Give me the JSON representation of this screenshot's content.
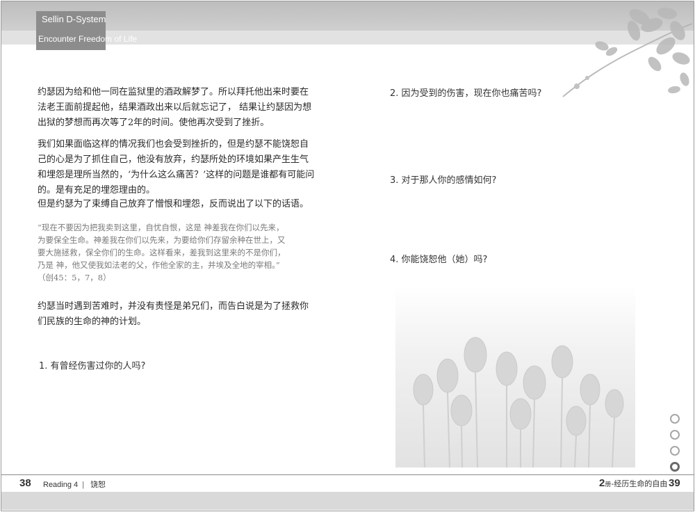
{
  "header": {
    "brand_title": "Sellin D-System",
    "brand_subtitle": "Encounter Freedom of Life"
  },
  "left_page": {
    "paragraphs": [
      "约瑟因为给和他一同在监狱里的酒政解梦了。所以拜托他出来时要在法老王面前提起他，结果酒政出来以后就忘记了， 结果让约瑟因为想出狱的梦想而再次等了2年的时间。使他再次受到了挫折。",
      "我们如果面临这样的情况我们也会受到挫折的，但是约瑟不能饶恕自己的心是为了抓住自己，他没有放弃，约瑟所处的环境如果产生生气和埋怨是理所当然的，‘为什么这么痛苦？’这样的问题是谁都有可能问的。是有充足的埋怨理由的。",
      "但是约瑟为了束缚自己放弃了憎恨和埋怨，反而说出了以下的话语。"
    ],
    "quote_lines": [
      "“现在不要因为把我卖到这里，自忧自恨，这是  神差我在你们以先来，",
      "为要保全生命。神差我在你们以先来，为要给你们存留余种在世上，又",
      "要大施拯救，保全你们的生命。这样看来，差我到这里来的不是你们，",
      "乃是  神，他又使我如法老的父，作他全家的主，并埃及全地的宰相。”",
      "（创45：5，7，8）"
    ],
    "closing_paragraph": "约瑟当时遇到苦难时，并没有责怪是弟兄们，而告白说是为了拯救你们民族的生命的神的计划。",
    "question_1": "1. 有曾经伤害过你的人吗?"
  },
  "right_page": {
    "question_2": "2. 因为受到的伤害，现在你也痛苦吗?",
    "question_3": "3. 对于那人你的感情如何?",
    "question_4": "4. 你能饶恕他（她）吗?"
  },
  "footer": {
    "left_page_number": "38",
    "left_label": "Reading 4",
    "left_separator": "|",
    "left_topic": "饶恕",
    "right_chapter_number": "2",
    "right_chapter_marker": "册",
    "right_chapter_title": "-经历生命的自由",
    "right_page_number": "39"
  },
  "page_indicator": {
    "count": 4,
    "active_index": 3
  },
  "colors": {
    "header_band": "#c6c6c6",
    "brand_box": "#8c8c8c",
    "quote_text": "#7a7a7a",
    "footer_band": "#d9d9d9"
  }
}
